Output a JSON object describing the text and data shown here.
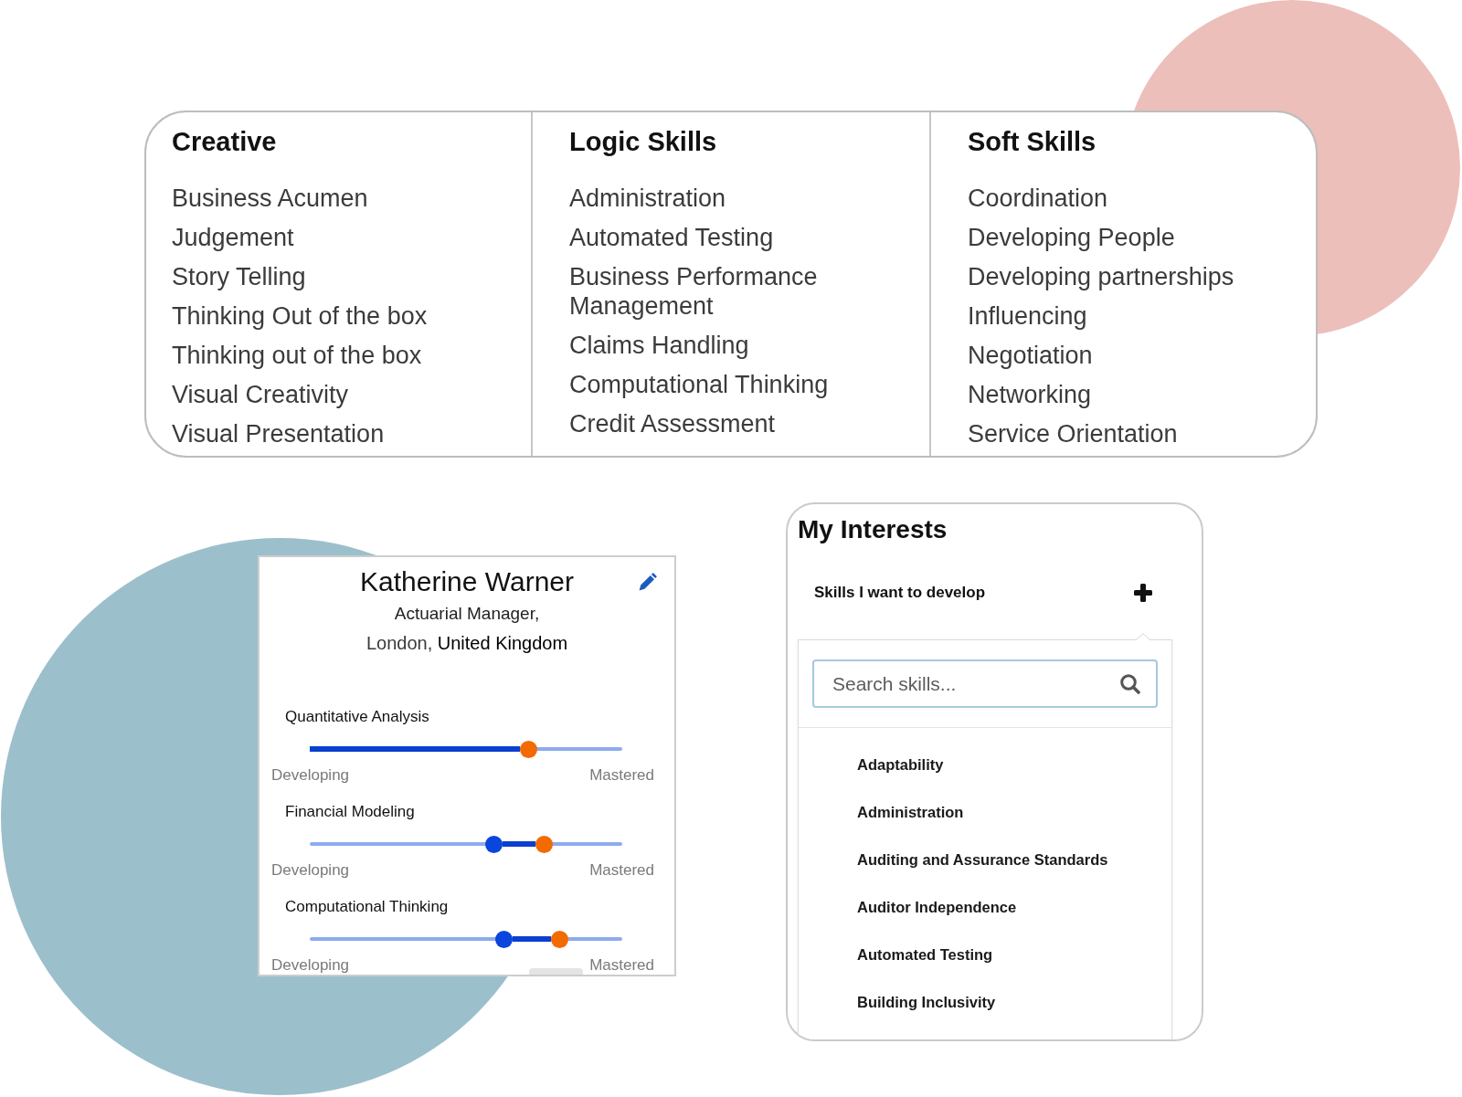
{
  "skill_categories": [
    {
      "heading": "Creative",
      "items": [
        "Business Acumen",
        "Judgement",
        "Story Telling",
        "Thinking Out of the box",
        "Thinking out of the box",
        "Visual Creativity",
        "Visual Presentation"
      ]
    },
    {
      "heading": "Logic Skills",
      "items": [
        "Administration",
        "Automated Testing",
        "Business Performance Management",
        "Claims Handling",
        "Computational Thinking",
        "Credit Assessment"
      ]
    },
    {
      "heading": "Soft Skills",
      "items": [
        "Coordination",
        "Developing People",
        "Developing partnerships",
        "Influencing",
        "Negotiation",
        "Networking",
        "Service Orientation"
      ]
    }
  ],
  "profile_card": {
    "name": "Katherine Warner",
    "job_title": "Actuarial Manager,",
    "location": "London, **United Kingdom**",
    "skills": [
      {
        "label": "Quantitative Analysis",
        "thumbs": [
          {
            "level": 0.7,
            "color": "#f26a00"
          }
        ],
        "min_label": "Developing",
        "max_label": "Mastered"
      },
      {
        "label": "Financial Modeling",
        "thumbs": [
          {
            "level": 0.59,
            "color": "#0a45dc"
          },
          {
            "level": 0.75,
            "color": "#f26a00"
          }
        ],
        "min_label": "Developing",
        "max_label": "Mastered"
      },
      {
        "label": "Computational Thinking",
        "thumbs": [
          {
            "level": 0.62,
            "color": "#0a45dc"
          },
          {
            "level": 0.8,
            "color": "#f26a00"
          }
        ],
        "min_label": "Developing",
        "max_label": "Mastered"
      }
    ]
  },
  "interests": {
    "title": "My Interests",
    "section_label": "Skills I want to develop",
    "dropdown": {
      "expanded": true,
      "search": {
        "placeholder": "Search skills..."
      },
      "options": [
        "Adaptability",
        "Administration",
        "Auditing and Assurance Standards",
        "Auditor Independence",
        "Automated Testing",
        "Building Inclusivity"
      ]
    }
  }
}
